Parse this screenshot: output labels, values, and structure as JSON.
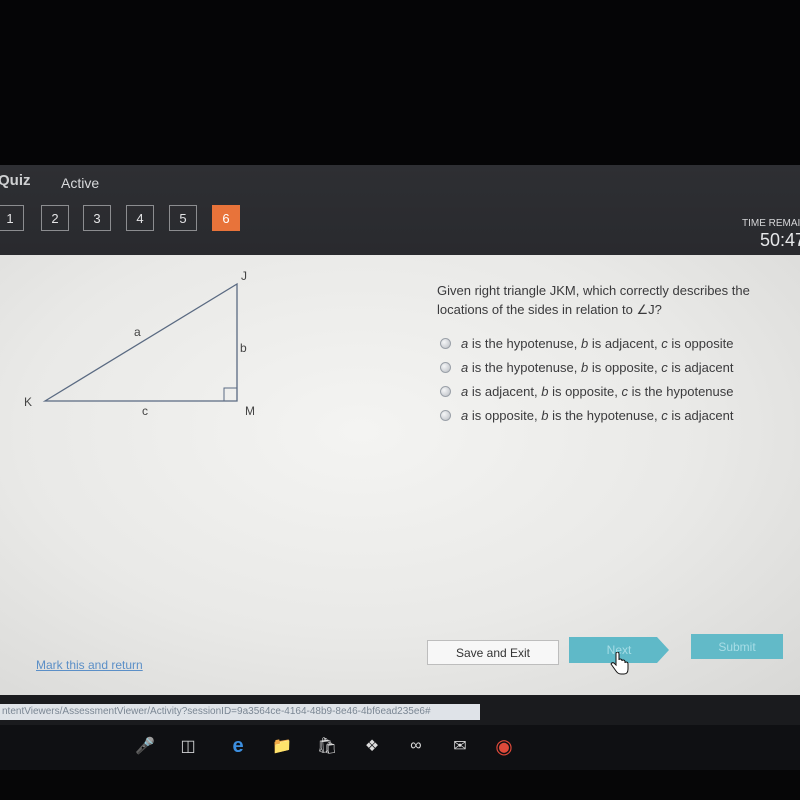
{
  "header": {
    "title": "Quiz",
    "status": "Active",
    "question_numbers": [
      "1",
      "2",
      "3",
      "4",
      "5",
      "6"
    ],
    "current_question": "6",
    "time_remaining_label": "TIME REMAI",
    "time_remaining_value": "50:47"
  },
  "question": {
    "text": "Given right triangle JKM, which correctly describes the locations of the sides in relation to ∠J?",
    "options": [
      {
        "a": "a",
        "t1": " is the hypotenuse, ",
        "b": "b",
        "t2": " is adjacent, ",
        "c": "c",
        "t3": " is opposite"
      },
      {
        "a": "a",
        "t1": " is the hypotenuse, ",
        "b": "b",
        "t2": " is opposite, ",
        "c": "c",
        "t3": " is adjacent"
      },
      {
        "a": "a",
        "t1": " is adjacent, ",
        "b": "b",
        "t2": " is opposite, ",
        "c": "c",
        "t3": " is the hypotenuse"
      },
      {
        "a": "a",
        "t1": " is opposite, ",
        "b": "b",
        "t2": " is the hypotenuse, ",
        "c": "c",
        "t3": " is adjacent"
      }
    ]
  },
  "diagram": {
    "vertices": {
      "J": "J",
      "K": "K",
      "M": "M"
    },
    "sides": {
      "a": "a",
      "b": "b",
      "c": "c"
    }
  },
  "footer": {
    "mark_link": "Mark this and return",
    "save_exit": "Save and Exit",
    "next": "Next",
    "submit": "Submit"
  },
  "browser": {
    "url": "ntentViewers/AssessmentViewer/Activity?sessionID=9a3564ce-4164-48b9-8e46-4bf6ead235e6#"
  },
  "taskbar": {
    "icons": [
      "microphone-icon",
      "task-view-icon",
      "edge-icon",
      "file-explorer-icon",
      "store-icon",
      "dropbox-icon",
      "infinity-icon",
      "mail-icon",
      "chrome-icon"
    ]
  },
  "colors": {
    "accent_current": "#e8733a",
    "button_teal": "#5fb9c8",
    "link_blue": "#5b8fc7"
  }
}
